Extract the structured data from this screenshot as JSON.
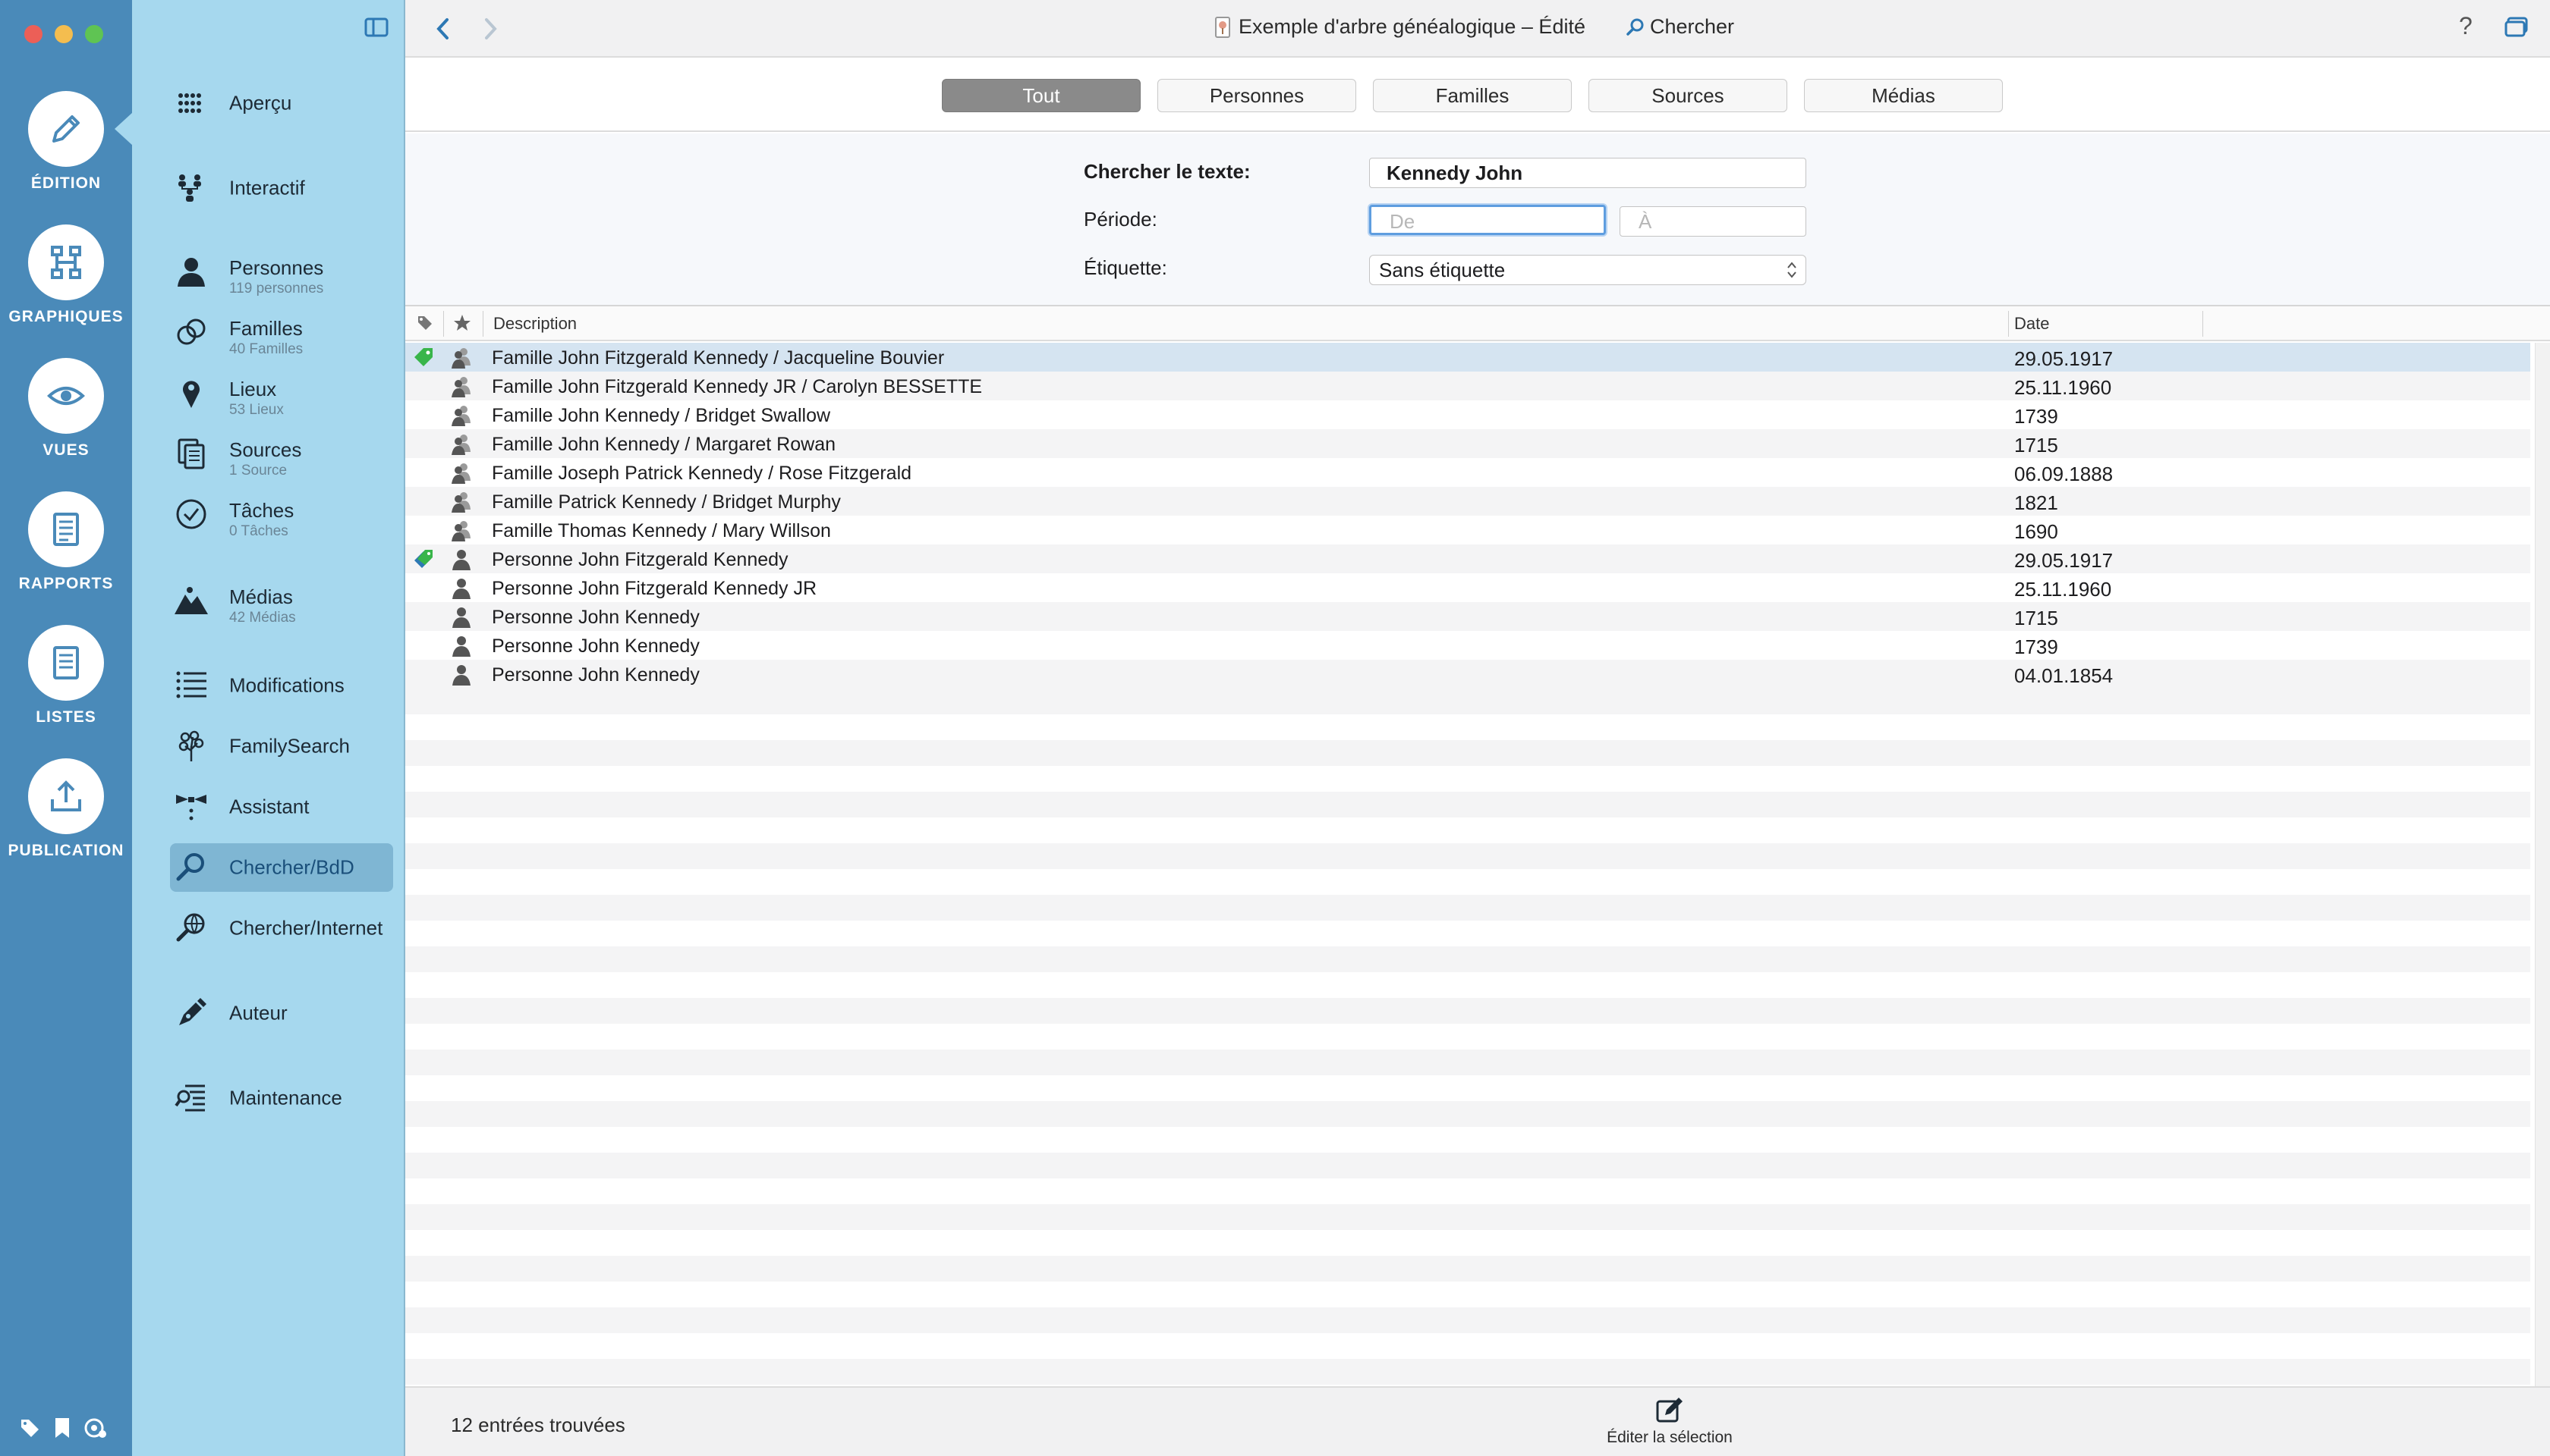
{
  "window": {
    "title": "Exemple d'arbre généalogique – Édité",
    "search_label": "Chercher",
    "help": "?"
  },
  "rail": {
    "modes": [
      {
        "label": "ÉDITION",
        "icon": "pencil-icon",
        "active": true
      },
      {
        "label": "GRAPHIQUES",
        "icon": "chart-icon"
      },
      {
        "label": "VUES",
        "icon": "eye-icon"
      },
      {
        "label": "RAPPORTS",
        "icon": "report-icon"
      },
      {
        "label": "LISTES",
        "icon": "list-icon"
      },
      {
        "label": "PUBLICATION",
        "icon": "upload-icon"
      }
    ],
    "colors": {
      "background": "#4a8ab9",
      "close": "#ec5f57",
      "minimize": "#f4bd4f",
      "zoom": "#5fc453"
    }
  },
  "sidebar": {
    "items": [
      {
        "label": "Aperçu",
        "sub": "",
        "icon": "grid-icon"
      },
      {
        "label": "Interactif",
        "sub": "",
        "icon": "tree-people-icon"
      },
      {
        "label": "Personnes",
        "sub": "119 personnes",
        "icon": "person-icon"
      },
      {
        "label": "Familles",
        "sub": "40 Familles",
        "icon": "rings-icon"
      },
      {
        "label": "Lieux",
        "sub": "53 Lieux",
        "icon": "pin-icon"
      },
      {
        "label": "Sources",
        "sub": "1 Source",
        "icon": "sources-icon"
      },
      {
        "label": "Tâches",
        "sub": "0 Tâches",
        "icon": "check-icon"
      },
      {
        "label": "Médias",
        "sub": "42 Médias",
        "icon": "mountain-icon"
      },
      {
        "label": "Modifications",
        "sub": "",
        "icon": "lines-icon"
      },
      {
        "label": "FamilySearch",
        "sub": "",
        "icon": "familysearch-icon"
      },
      {
        "label": "Assistant",
        "sub": "",
        "icon": "bowtie-icon"
      },
      {
        "label": "Chercher/BdD",
        "sub": "",
        "icon": "magnifier-icon"
      },
      {
        "label": "Chercher/Internet",
        "sub": "",
        "icon": "globe-search-icon"
      },
      {
        "label": "Auteur",
        "sub": "",
        "icon": "pen-nib-icon"
      },
      {
        "label": "Maintenance",
        "sub": "",
        "icon": "maintenance-icon"
      }
    ],
    "active": "Chercher/BdD"
  },
  "tabs": [
    {
      "label": "Tout",
      "active": true
    },
    {
      "label": "Personnes"
    },
    {
      "label": "Familles"
    },
    {
      "label": "Sources"
    },
    {
      "label": "Médias"
    }
  ],
  "form": {
    "text_label": "Chercher le texte:",
    "text_value": "Kennedy John",
    "period_label": "Période:",
    "from_placeholder": "De",
    "to_placeholder": "À",
    "tag_label": "Étiquette:",
    "tag_value": "Sans étiquette"
  },
  "table": {
    "headers": {
      "description": "Description",
      "date": "Date"
    },
    "rows": [
      {
        "description": "Famille John Fitzgerald Kennedy / Jacqueline Bouvier",
        "date": "29.05.1917",
        "type": "family",
        "tag": "green",
        "selected": true
      },
      {
        "description": "Famille John Fitzgerald Kennedy JR / Carolyn BESSETTE",
        "date": "25.11.1960",
        "type": "family"
      },
      {
        "description": "Famille John Kennedy / Bridget Swallow",
        "date": "1739",
        "type": "family"
      },
      {
        "description": "Famille John Kennedy / Margaret Rowan",
        "date": "1715",
        "type": "family"
      },
      {
        "description": "Famille Joseph Patrick Kennedy / Rose Fitzgerald",
        "date": "06.09.1888",
        "type": "family"
      },
      {
        "description": "Famille Patrick Kennedy / Bridget Murphy",
        "date": "1821",
        "type": "family"
      },
      {
        "description": "Famille Thomas Kennedy / Mary Willson",
        "date": "1690",
        "type": "family"
      },
      {
        "description": "Personne John Fitzgerald Kennedy",
        "date": "29.05.1917",
        "type": "person",
        "tag": "green-blue"
      },
      {
        "description": "Personne John Fitzgerald Kennedy JR",
        "date": "25.11.1960",
        "type": "person"
      },
      {
        "description": "Personne John Kennedy",
        "date": "1715",
        "type": "person"
      },
      {
        "description": "Personne John Kennedy",
        "date": "1739",
        "type": "person"
      },
      {
        "description": "Personne John Kennedy",
        "date": "04.01.1854",
        "type": "person"
      }
    ]
  },
  "footer": {
    "count": "12 entrées trouvées",
    "edit_label": "Éditer la sélection"
  }
}
